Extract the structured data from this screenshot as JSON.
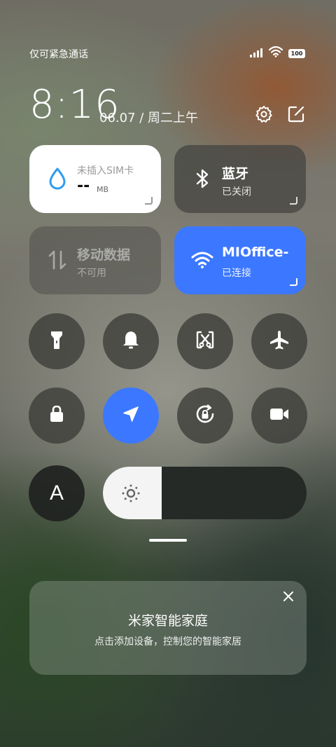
{
  "status": {
    "carrier": "仅可紧急通话",
    "battery": "100",
    "icons": [
      "signal-icon",
      "wifi-icon",
      "battery-icon"
    ]
  },
  "header": {
    "time": "8:16",
    "date": "06.07 / 周二上午",
    "icons": [
      "settings-icon",
      "edit-icon"
    ]
  },
  "tiles": {
    "data": {
      "title": "未插入SIM卡",
      "value": "--",
      "unit": "MB",
      "icon": "water-drop-icon"
    },
    "bluetooth": {
      "title": "蓝牙",
      "status": "已关闭",
      "icon": "bluetooth-icon"
    },
    "mobile": {
      "title": "移动数据",
      "status": "不可用",
      "icon": "mobile-data-icon"
    },
    "wifi": {
      "title": "MIOffice-",
      "status": "已连接",
      "icon": "wifi-icon"
    }
  },
  "toggles": {
    "row1": [
      "flashlight-icon",
      "bell-icon",
      "screenshot-icon",
      "airplane-icon"
    ],
    "row2": [
      "lock-icon",
      "location-icon",
      "rotation-lock-icon",
      "video-icon"
    ],
    "font_button": "A"
  },
  "brightness": {
    "level_percent": 29,
    "icon": "sun-icon"
  },
  "card": {
    "title": "米家智能家庭",
    "subtitle": "点击添加设备，控制您的智能家居",
    "close_icon": "close-icon"
  },
  "colors": {
    "accent": "#3c78ff"
  }
}
